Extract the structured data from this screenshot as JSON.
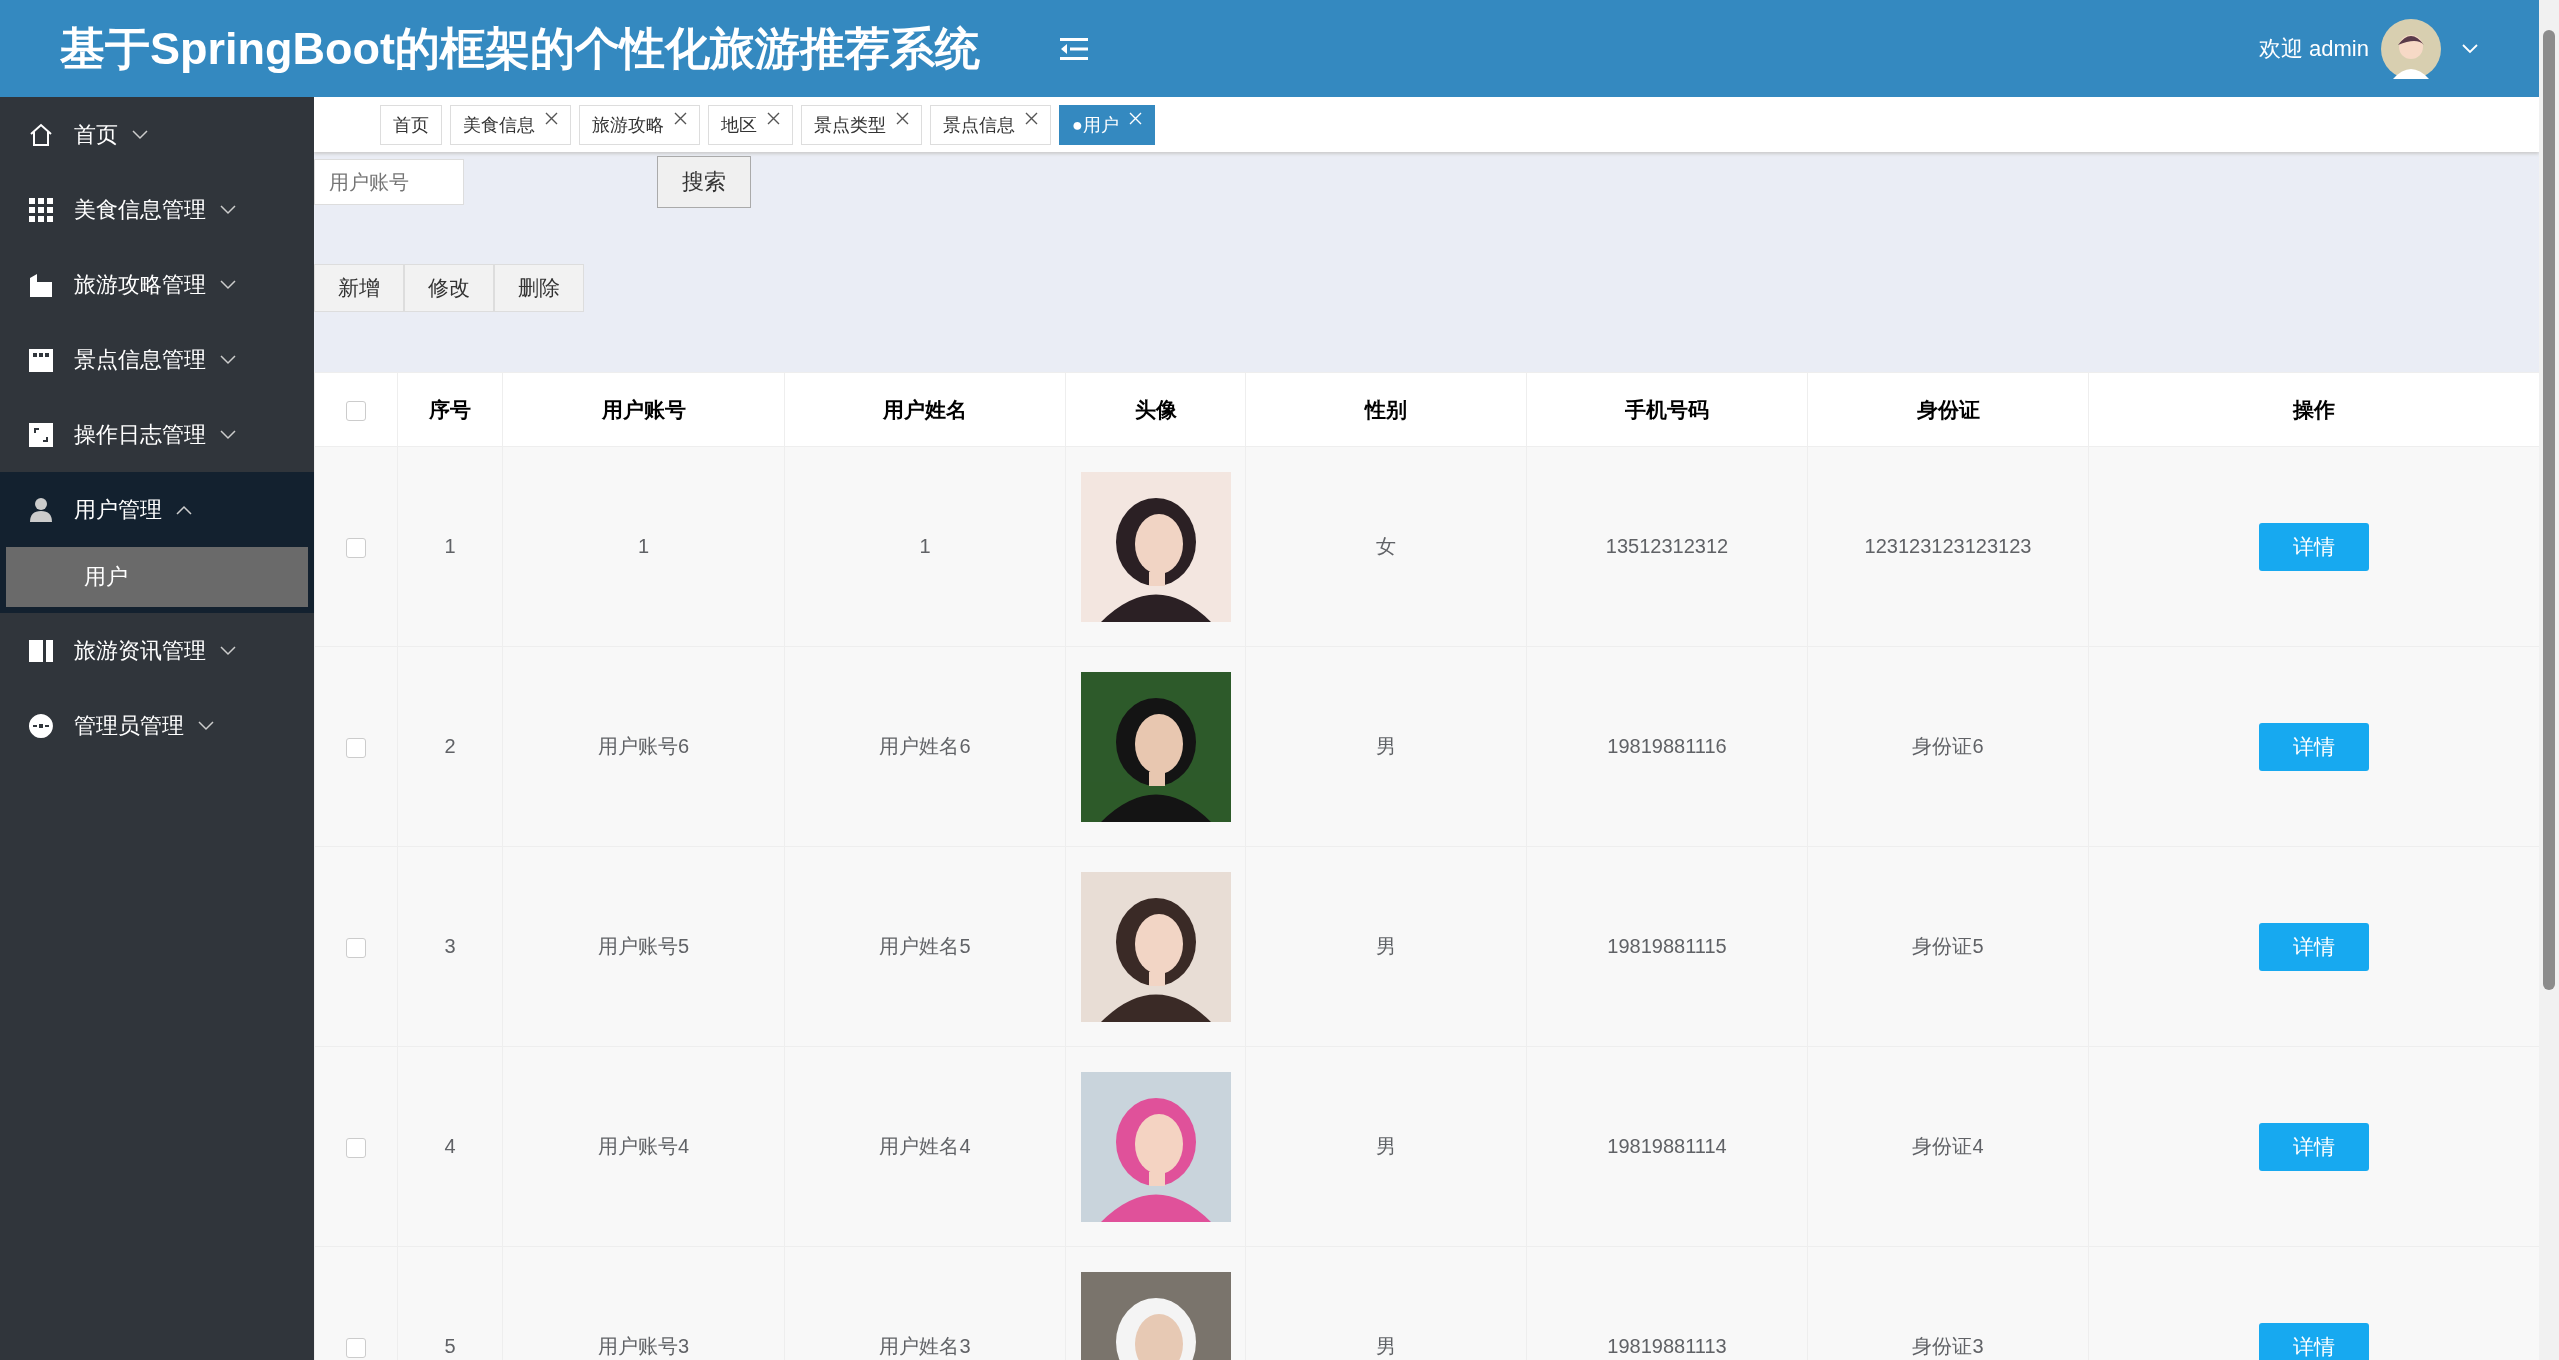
{
  "header": {
    "title": "基于SpringBoot的框架的个性化旅游推荐系统",
    "greeting": "欢迎 admin"
  },
  "sidebar": {
    "items": [
      {
        "label": "首页",
        "expanded": false
      },
      {
        "label": "美食信息管理",
        "expanded": false
      },
      {
        "label": "旅游攻略管理",
        "expanded": false
      },
      {
        "label": "景点信息管理",
        "expanded": false
      },
      {
        "label": "操作日志管理",
        "expanded": false
      },
      {
        "label": "用户管理",
        "expanded": true,
        "children": [
          {
            "label": "用户",
            "selected": true
          }
        ]
      },
      {
        "label": "旅游资讯管理",
        "expanded": false
      },
      {
        "label": "管理员管理",
        "expanded": false
      }
    ]
  },
  "tabs": [
    {
      "label": "首页",
      "selected": false,
      "closable": false
    },
    {
      "label": "美食信息",
      "selected": false,
      "closable": true
    },
    {
      "label": "旅游攻略",
      "selected": false,
      "closable": true
    },
    {
      "label": "地区",
      "selected": false,
      "closable": true
    },
    {
      "label": "景点类型",
      "selected": false,
      "closable": true
    },
    {
      "label": "景点信息",
      "selected": false,
      "closable": true
    },
    {
      "label": "●用户",
      "selected": true,
      "closable": true
    }
  ],
  "search": {
    "placeholder": "用户账号",
    "button": "搜索"
  },
  "actions": [
    "新增",
    "修改",
    "删除"
  ],
  "table": {
    "all_checked": false,
    "columns": [
      "序号",
      "用户账号",
      "用户姓名",
      "头像",
      "性别",
      "手机号码",
      "身份证",
      "操作"
    ],
    "rows": [
      {
        "checked": false,
        "cells": [
          "1",
          "1",
          "1",
          {
            "kind": "picture"
          },
          "女",
          "13512312312",
          "123123123123123"
        ],
        "action": "详情"
      },
      {
        "checked": false,
        "cells": [
          "2",
          "用户账号6",
          "用户姓名6",
          {
            "kind": "picture"
          },
          "男",
          "19819881116",
          "身份证6"
        ],
        "action": "详情"
      },
      {
        "checked": false,
        "cells": [
          "3",
          "用户账号5",
          "用户姓名5",
          {
            "kind": "picture"
          },
          "男",
          "19819881115",
          "身份证5"
        ],
        "action": "详情"
      },
      {
        "checked": false,
        "cells": [
          "4",
          "用户账号4",
          "用户姓名4",
          {
            "kind": "picture"
          },
          "男",
          "19819881114",
          "身份证4"
        ],
        "action": "详情"
      },
      {
        "checked": false,
        "cells": [
          "5",
          "用户账号3",
          "用户姓名3",
          {
            "kind": "picture"
          },
          "男",
          "19819881113",
          "身份证3"
        ],
        "action": "详情"
      }
    ]
  }
}
